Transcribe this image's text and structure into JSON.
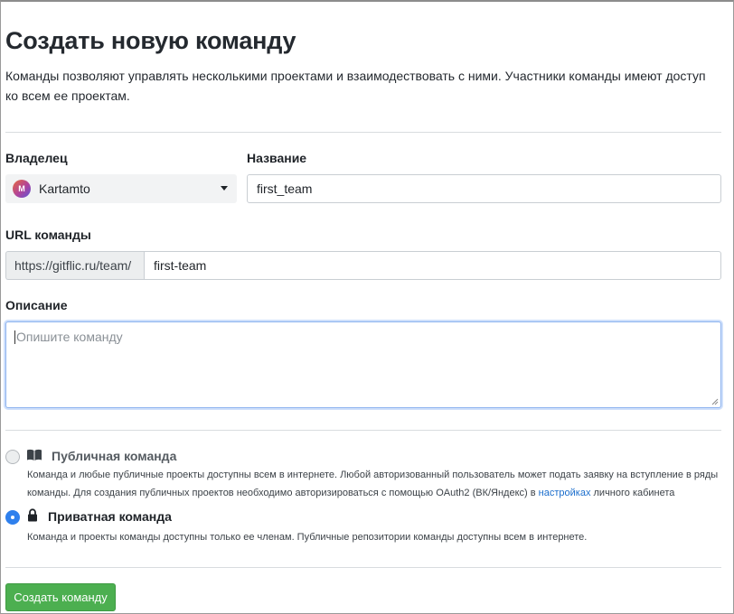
{
  "page": {
    "title": "Создать новую команду",
    "subtitle": "Команды позволяют управлять несколькими проектами и взаимодествовать с ними. Участники команды имеют доступ ко всем ее проектам."
  },
  "owner": {
    "label": "Владелец",
    "avatar_letter": "M",
    "value": "Kartamto"
  },
  "name_field": {
    "label": "Название",
    "value": "first_team"
  },
  "url_field": {
    "label": "URL команды",
    "prefix": "https://gitflic.ru/team/",
    "value": "first-team"
  },
  "description": {
    "label": "Описание",
    "placeholder": "Опишите команду"
  },
  "visibility": {
    "public": {
      "title": "Публичная команда",
      "icon": "book-icon",
      "selected": false,
      "desc_line1": "Команда и любые публичные проекты доступны всем в интернете. Любой авторизованный пользователь может подать заявку на вступление в ряды",
      "desc_line2_before": "команды. Для создания публичных проектов необходимо авторизироваться с помощью OAuth2 (ВК/Яндекс) в ",
      "desc_link": "настройках",
      "desc_line2_after": " личного кабинета"
    },
    "private": {
      "title": "Приватная команда",
      "icon": "lock-icon",
      "selected": true,
      "desc": "Команда и проекты команды доступны только ее членам. Публичные репозитории команды доступны всем в интернете."
    }
  },
  "submit": {
    "label": "Создать команду"
  },
  "colors": {
    "accent": "#2f80ed",
    "submit": "#4caf50",
    "link": "#1a6dcc",
    "focus_border": "#8db3ef"
  }
}
